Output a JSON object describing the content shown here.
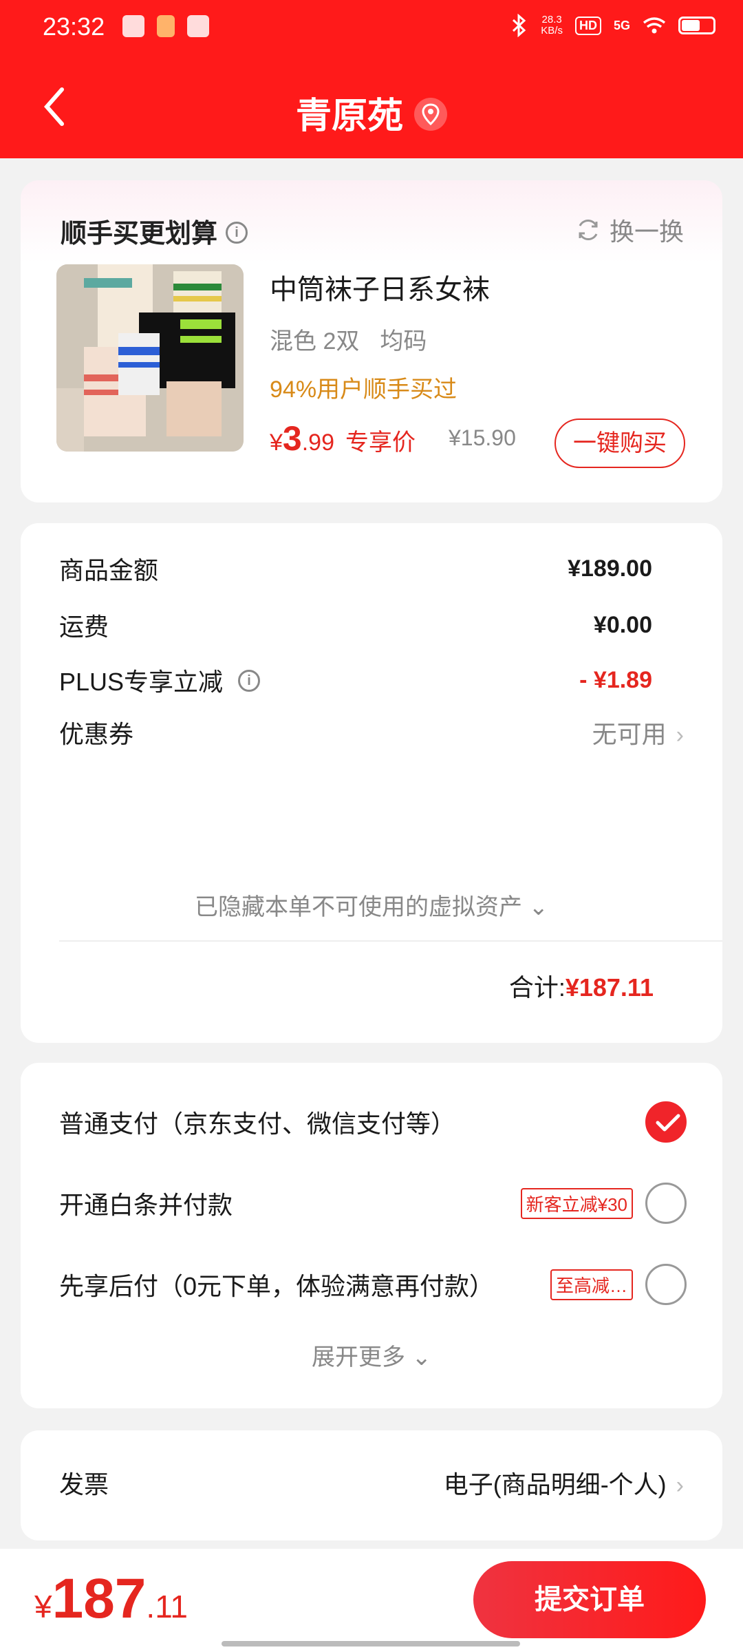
{
  "status_bar": {
    "time": "23:32",
    "speed_value": "28.3",
    "speed_unit": "KB/s",
    "hd": "HD",
    "network": "5G"
  },
  "header": {
    "title": "青原苑",
    "back_icon": "chevron-left-icon",
    "location_icon": "location-pin-icon"
  },
  "recommend": {
    "title": "顺手买更划算",
    "swap_label": "换一换",
    "product": {
      "name": "中筒袜子日系女袜",
      "spec_color": "混色 2双",
      "spec_size": "均码",
      "promo": "94%用户顺手买过",
      "price_symbol": "¥",
      "price_int": "3",
      "price_dec": ".99",
      "price_tag": "专享价",
      "original_price": "¥15.90",
      "buy_button": "一键购买"
    }
  },
  "summary": {
    "goods_label": "商品金额",
    "goods_value": "¥189.00",
    "shipping_label": "运费",
    "shipping_value": "¥0.00",
    "plus_label": "PLUS专享立减",
    "plus_value": "- ¥1.89",
    "coupon_label": "优惠券",
    "coupon_value": "无可用",
    "hidden_assets": "已隐藏本单不可使用的虚拟资产",
    "total_label": "合计:",
    "total_value": "¥187.11"
  },
  "payment": {
    "options": [
      {
        "label": "普通支付（京东支付、微信支付等）",
        "badge": "",
        "selected": true
      },
      {
        "label": "开通白条并付款",
        "badge": "新客立减¥30",
        "selected": false
      },
      {
        "label": "先享后付（0元下单，体验满意再付款）",
        "badge": "至高减…",
        "selected": false
      }
    ],
    "expand_more": "展开更多"
  },
  "invoice": {
    "label": "发票",
    "value": "电子(商品明细-个人)"
  },
  "bottom": {
    "yen": "¥",
    "price_int": "187",
    "price_dec": ".11",
    "submit": "提交订单"
  },
  "colors": {
    "brand_red": "#ff1a1a",
    "price_red": "#e5261f",
    "promo_orange": "#d88a18"
  }
}
